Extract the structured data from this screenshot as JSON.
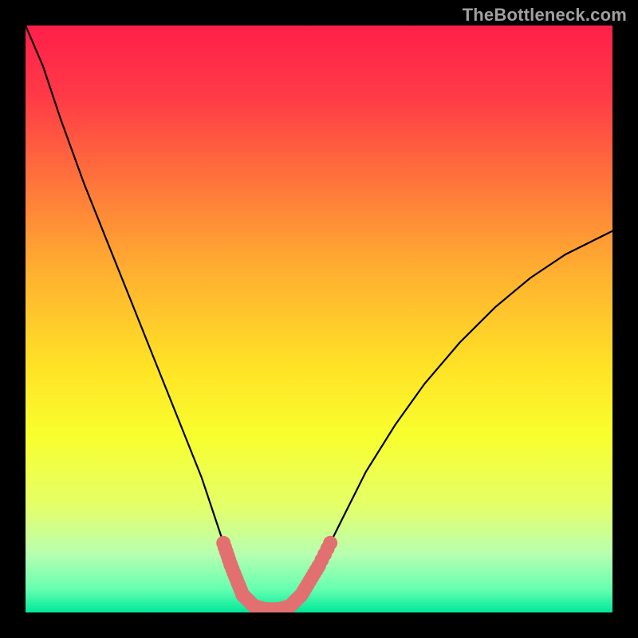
{
  "watermark": "TheBottleneck.com",
  "chart_data": {
    "type": "line",
    "title": "",
    "xlabel": "",
    "ylabel": "",
    "xlim": [
      0,
      100
    ],
    "ylim": [
      0,
      100
    ],
    "curve": [
      {
        "x": 0,
        "y": 100
      },
      {
        "x": 3,
        "y": 93
      },
      {
        "x": 6,
        "y": 84
      },
      {
        "x": 10,
        "y": 73
      },
      {
        "x": 14,
        "y": 63
      },
      {
        "x": 18,
        "y": 53
      },
      {
        "x": 22,
        "y": 43
      },
      {
        "x": 26,
        "y": 33
      },
      {
        "x": 30,
        "y": 23
      },
      {
        "x": 33,
        "y": 14
      },
      {
        "x": 35,
        "y": 8
      },
      {
        "x": 37,
        "y": 3
      },
      {
        "x": 39,
        "y": 1
      },
      {
        "x": 41,
        "y": 0.5
      },
      {
        "x": 43,
        "y": 0.5
      },
      {
        "x": 45,
        "y": 1
      },
      {
        "x": 47,
        "y": 3
      },
      {
        "x": 50,
        "y": 8
      },
      {
        "x": 54,
        "y": 16
      },
      {
        "x": 58,
        "y": 24
      },
      {
        "x": 63,
        "y": 32
      },
      {
        "x": 68,
        "y": 39
      },
      {
        "x": 74,
        "y": 46
      },
      {
        "x": 80,
        "y": 52
      },
      {
        "x": 86,
        "y": 57
      },
      {
        "x": 92,
        "y": 61
      },
      {
        "x": 100,
        "y": 65
      }
    ],
    "marker_band": {
      "y_min": 0,
      "y_max": 12
    },
    "gradient_stops": [
      {
        "offset": 0.0,
        "color": "#ff1f4a"
      },
      {
        "offset": 0.12,
        "color": "#ff3a47"
      },
      {
        "offset": 0.28,
        "color": "#ff7a3a"
      },
      {
        "offset": 0.42,
        "color": "#ffb030"
      },
      {
        "offset": 0.58,
        "color": "#ffe226"
      },
      {
        "offset": 0.7,
        "color": "#f8ff2e"
      },
      {
        "offset": 0.82,
        "color": "#e4ff6a"
      },
      {
        "offset": 0.9,
        "color": "#b8ffb0"
      },
      {
        "offset": 0.96,
        "color": "#66ffb0"
      },
      {
        "offset": 1.0,
        "color": "#00e89a"
      }
    ],
    "marker_color": "#e37070",
    "curve_color": "#000000"
  }
}
